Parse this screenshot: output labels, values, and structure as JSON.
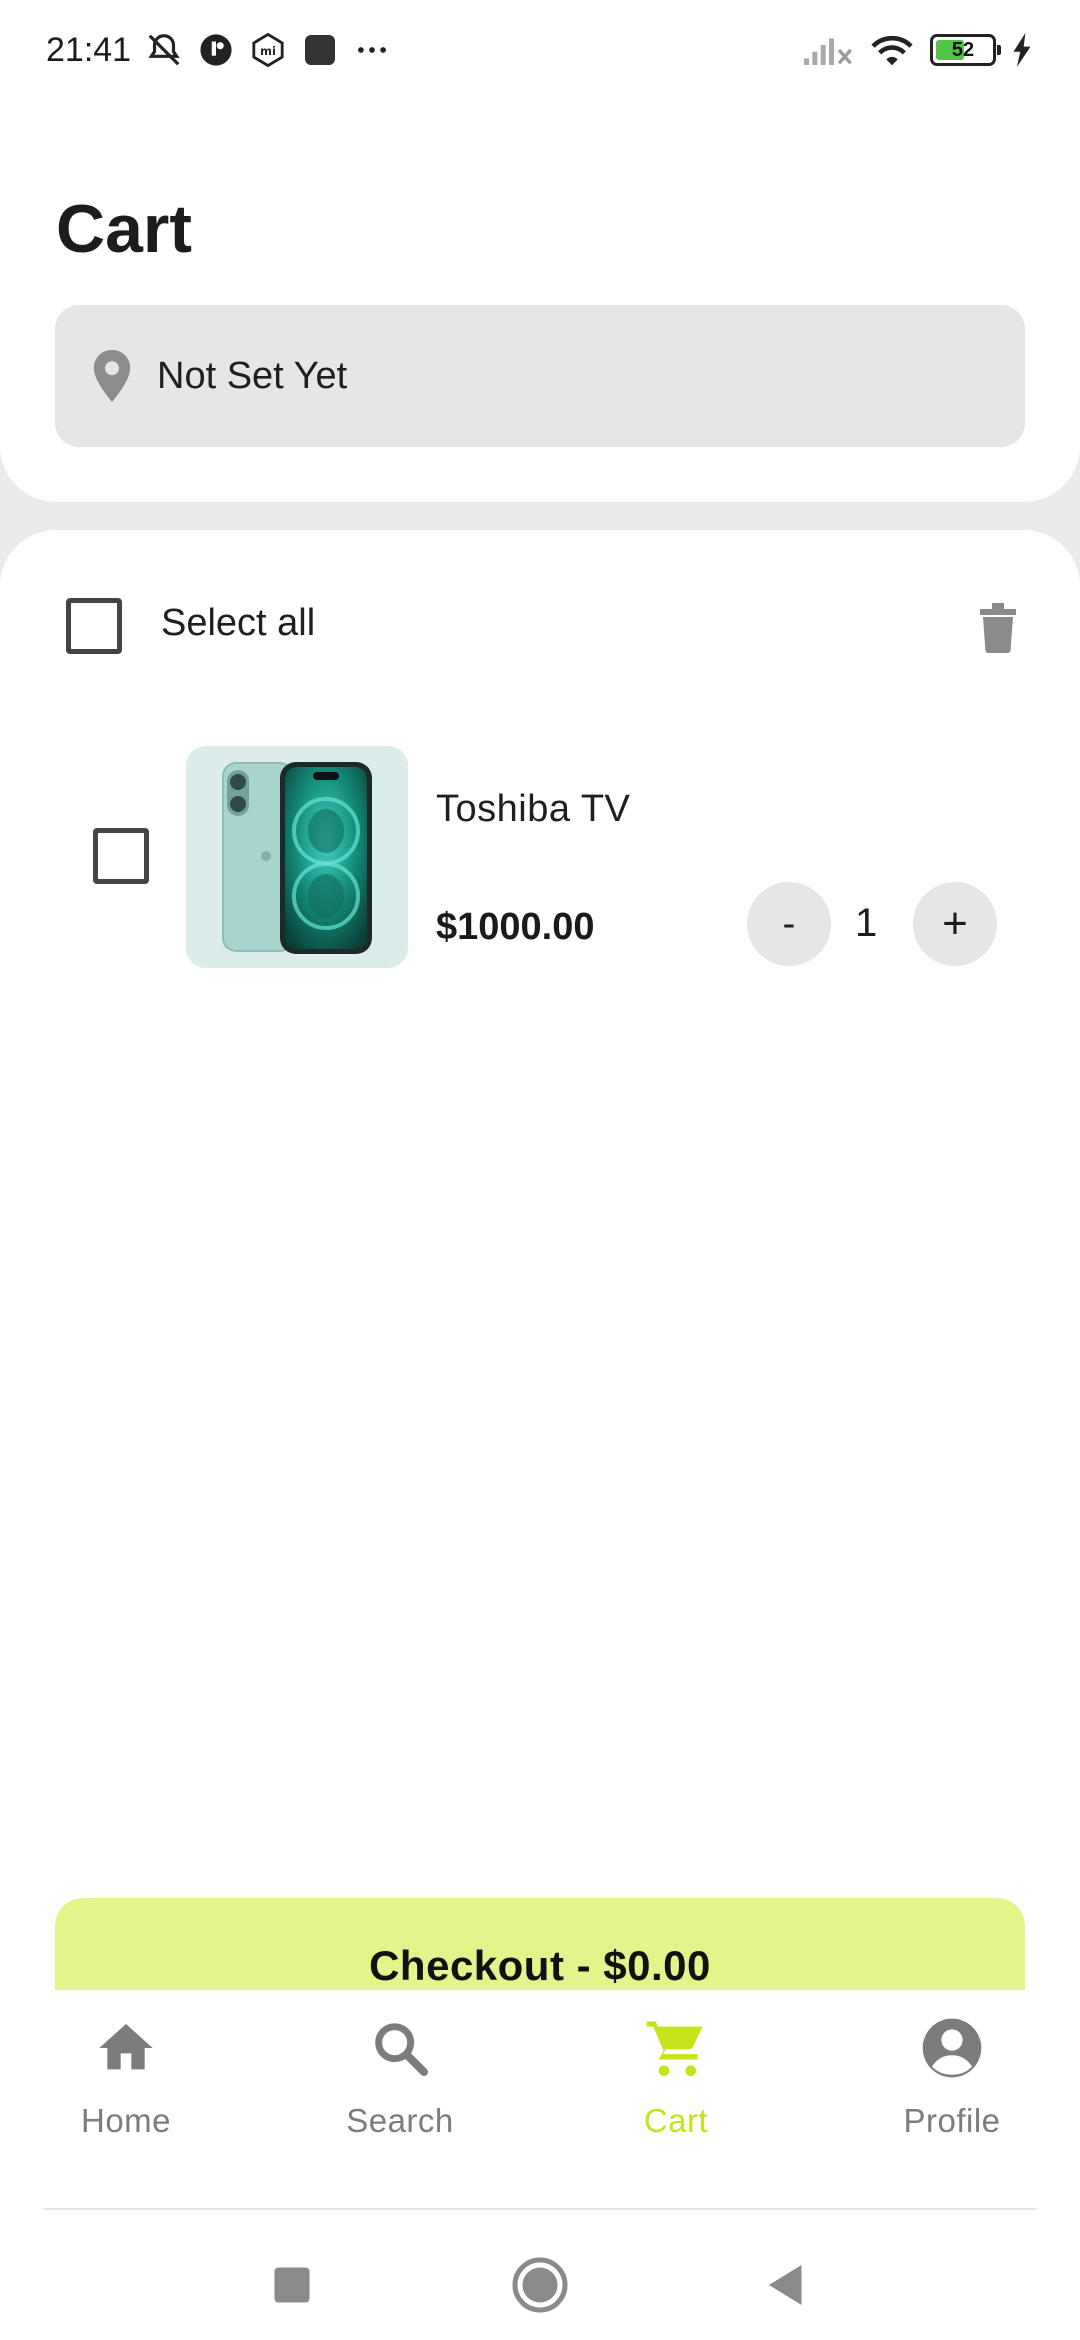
{
  "status_bar": {
    "time": "21:41",
    "battery_level": "52",
    "battery_fraction": 0.52,
    "icons": [
      "mute-icon",
      "app-icon",
      "mi-icon",
      "square-icon",
      "more-icon",
      "signal-icon",
      "wifi-icon",
      "battery-icon",
      "charging-icon"
    ]
  },
  "header": {
    "title": "Cart",
    "location_text": "Not Set Yet"
  },
  "cart": {
    "select_all_label": "Select all",
    "items": [
      {
        "name": "Toshiba TV",
        "price": "$1000.00",
        "quantity": "1",
        "minus_label": "-",
        "plus_label": "+"
      }
    ]
  },
  "checkout": {
    "label": "Checkout - $0.00"
  },
  "nav": {
    "items": [
      {
        "label": "Home",
        "icon": "home-icon"
      },
      {
        "label": "Search",
        "icon": "search-icon"
      },
      {
        "label": "Cart",
        "icon": "cart-icon",
        "active": true
      },
      {
        "label": "Profile",
        "icon": "profile-icon"
      }
    ]
  },
  "colors": {
    "accent": "#c6e31c",
    "checkout_bg": "#e2f58a",
    "inactive": "#7c7c7c",
    "background": "#ebebeb"
  }
}
